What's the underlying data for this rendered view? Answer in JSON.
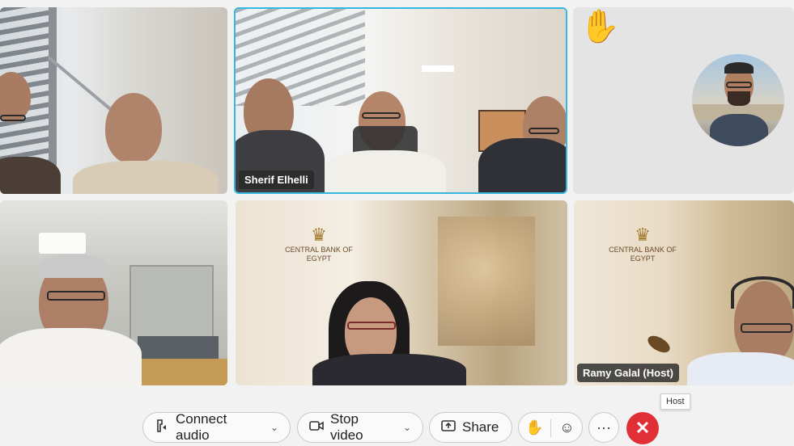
{
  "participants": [
    {
      "id": "tile-1",
      "name": ""
    },
    {
      "id": "tile-2",
      "name": "Sherif Elhelli",
      "active": true
    },
    {
      "id": "tile-3",
      "name": "",
      "raised_hand": true,
      "raised_hand_icon": "raised-hand-icon"
    },
    {
      "id": "tile-4",
      "name": ""
    },
    {
      "id": "tile-5",
      "name": "",
      "logo_text": "CENTRAL BANK OF EGYPT"
    },
    {
      "id": "tile-6",
      "name": "Ramy Galal (Host)",
      "logo_text": "CENTRAL BANK OF EGYPT"
    }
  ],
  "toolbar": {
    "connect_audio": "Connect audio",
    "stop_video": "Stop video",
    "share": "Share",
    "more": "···",
    "end": "✕"
  },
  "tooltip": "Host",
  "colors": {
    "active_border": "#35b7e0",
    "end_button": "#e02f36",
    "toolbar_bg": "#f2f2f2"
  }
}
